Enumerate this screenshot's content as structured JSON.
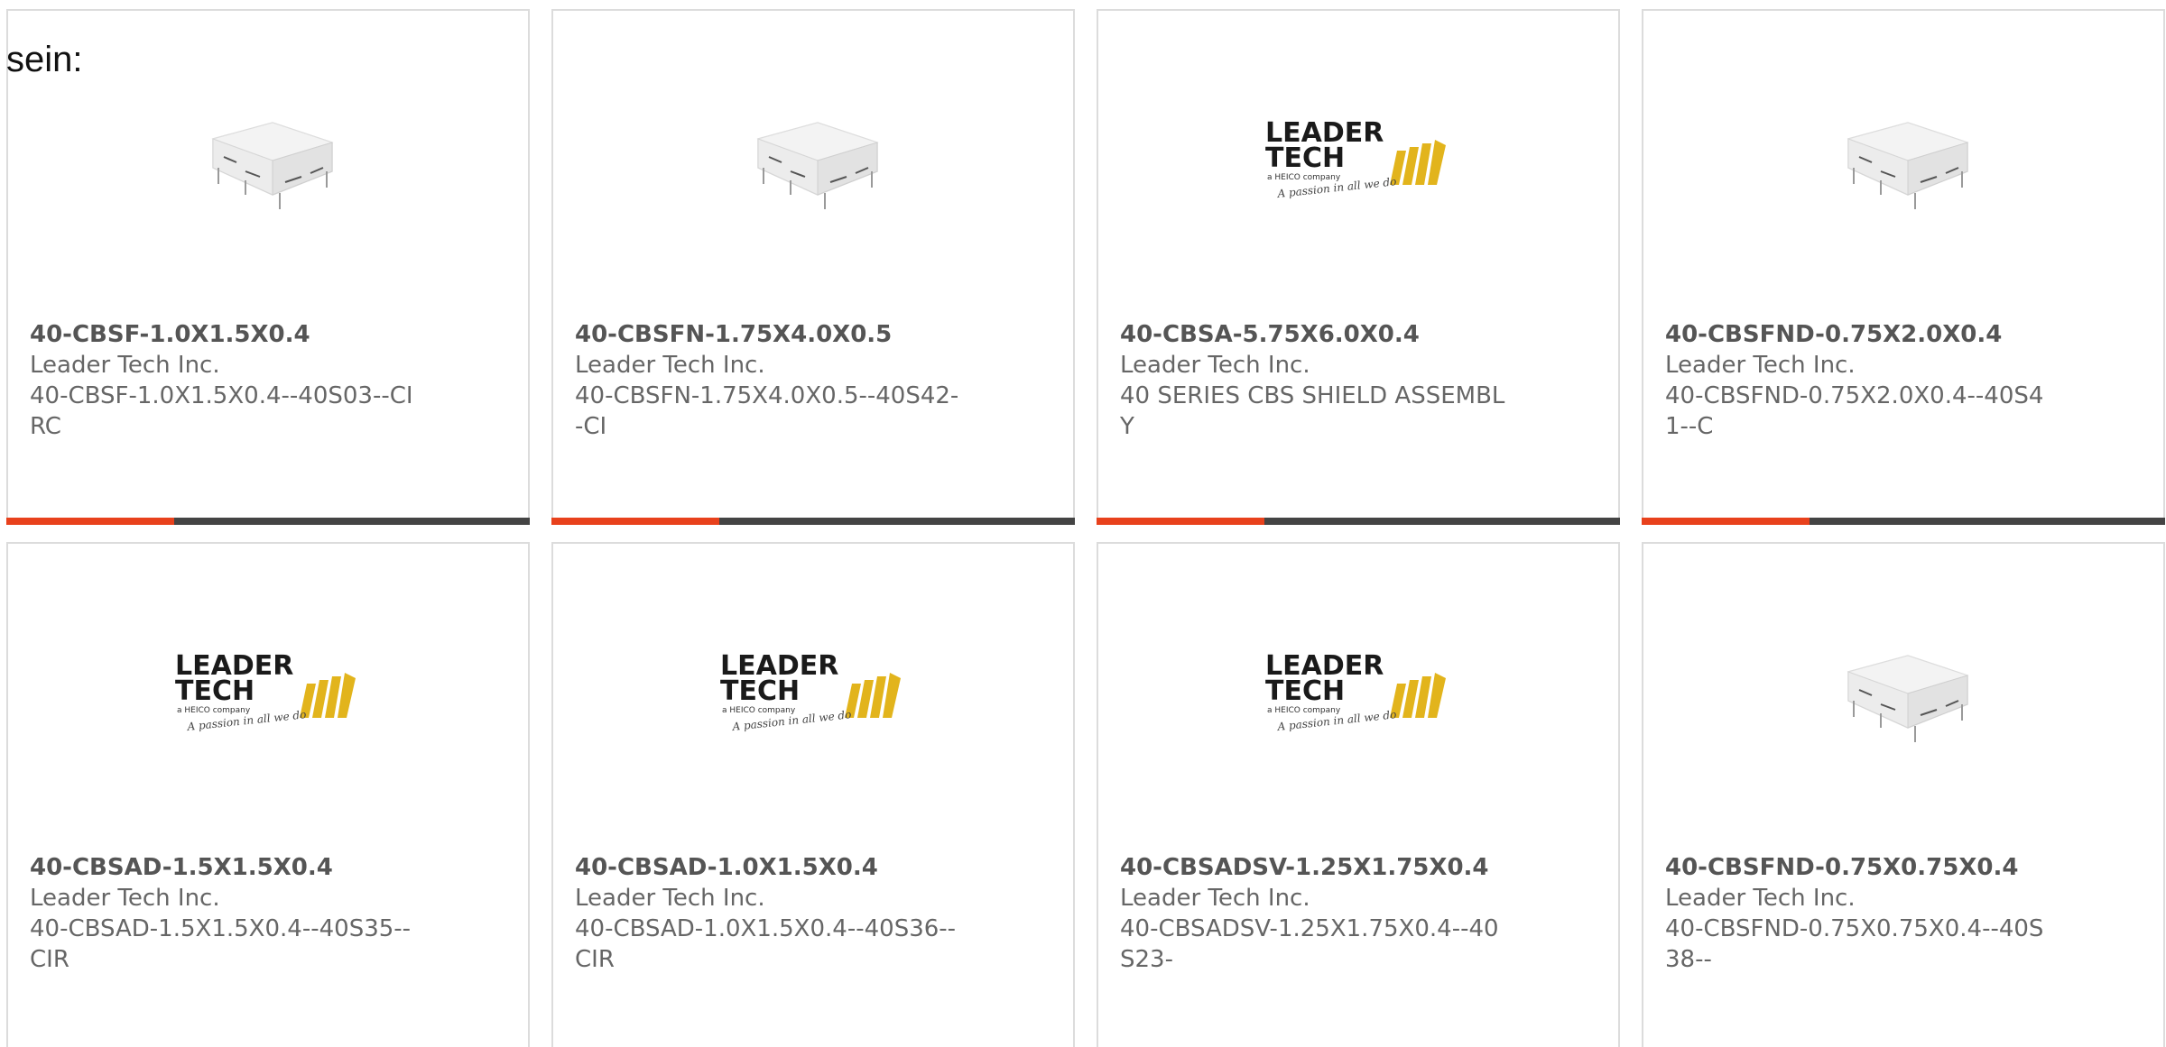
{
  "intro_text": "sein:",
  "accent_color": "#e8411c",
  "track_color": "#444444",
  "products": [
    {
      "title": "40-CBSF-1.0X1.5X0.4",
      "manufacturer": "Leader Tech Inc.",
      "description": "40-CBSF-1.0X1.5X0.4--40S03--CIRC",
      "image": "shield-can-photo",
      "progress": 0.32
    },
    {
      "title": "40-CBSFN-1.75X4.0X0.5",
      "manufacturer": "Leader Tech Inc.",
      "description": "40-CBSFN-1.75X4.0X0.5--40S42--CI",
      "image": "shield-can-photo",
      "progress": 0.32
    },
    {
      "title": "40-CBSA-5.75X6.0X0.4",
      "manufacturer": "Leader Tech Inc.",
      "description": "40 SERIES CBS SHIELD ASSEMBLY",
      "image": "leader-tech-logo",
      "progress": 0.32
    },
    {
      "title": "40-CBSFND-0.75X2.0X0.4",
      "manufacturer": "Leader Tech Inc.",
      "description": "40-CBSFND-0.75X2.0X0.4--40S41--C",
      "image": "shield-can-photo",
      "progress": 0.32
    },
    {
      "title": "40-CBSAD-1.5X1.5X0.4",
      "manufacturer": "Leader Tech Inc.",
      "description": "40-CBSAD-1.5X1.5X0.4--40S35--CIR",
      "image": "leader-tech-logo"
    },
    {
      "title": "40-CBSAD-1.0X1.5X0.4",
      "manufacturer": "Leader Tech Inc.",
      "description": "40-CBSAD-1.0X1.5X0.4--40S36--CIR",
      "image": "leader-tech-logo"
    },
    {
      "title": "40-CBSADSV-1.25X1.75X0.4",
      "manufacturer": "Leader Tech Inc.",
      "description": "40-CBSADSV-1.25X1.75X0.4--40S23-",
      "image": "leader-tech-logo"
    },
    {
      "title": "40-CBSFND-0.75X0.75X0.4",
      "manufacturer": "Leader Tech Inc.",
      "description": "40-CBSFND-0.75X0.75X0.4--40S38--",
      "image": "shield-can-photo"
    }
  ],
  "logo": {
    "line1": "LEADER",
    "line2": "TECH",
    "company": "a HEICO company",
    "tagline": "A passion in all we do"
  }
}
